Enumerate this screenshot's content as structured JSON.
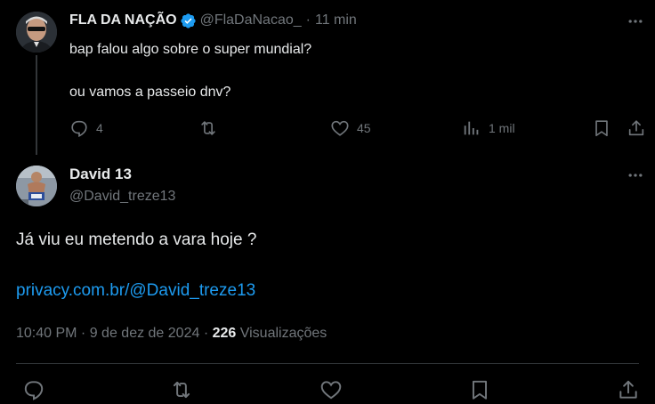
{
  "tweet1": {
    "author_name": "FLA DA NAÇÃO",
    "handle": "@FlaDaNacao_",
    "separator": "·",
    "time": "11 min",
    "lines": [
      "bap falou algo sobre o super mundial?",
      "ou vamos a passeio dnv?"
    ],
    "actions": {
      "reply_count": "4",
      "like_count": "45",
      "views_count": "1 mil"
    }
  },
  "tweet2": {
    "author_name": "David 13",
    "handle": "@David_treze13",
    "text": "Já viu eu metendo a vara hoje ?",
    "link": "privacy.com.br/@David_treze13",
    "timestamp": "10:40 PM · 9 de dez de 2024 · ",
    "views_count": "226",
    "views_label": " Visualizações"
  },
  "colors": {
    "background": "#000000",
    "text_primary": "#e7e9ea",
    "text_secondary": "#71767b",
    "link": "#1d9bf0",
    "verified": "#1d9bf0",
    "divider": "#2f3336"
  },
  "icons": {
    "tweet1": [
      "verified-badge-icon",
      "more-icon",
      "reply-icon",
      "retweet-icon",
      "like-icon",
      "views-icon",
      "bookmark-icon",
      "share-icon"
    ],
    "tweet2": [
      "more-icon",
      "reply-icon",
      "retweet-icon",
      "like-icon",
      "bookmark-icon",
      "share-icon"
    ]
  }
}
